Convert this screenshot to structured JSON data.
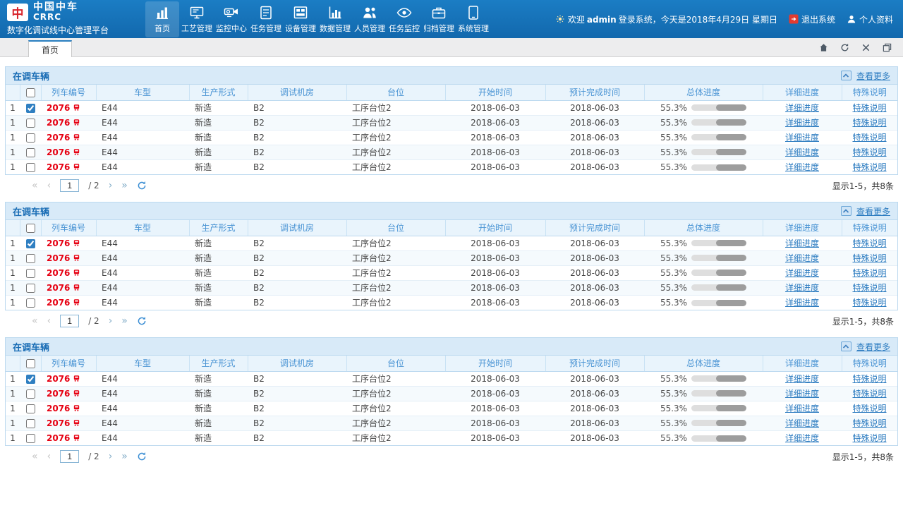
{
  "header": {
    "brand_cn": "中国中车",
    "brand_en": "CRRC",
    "logo_glyph": "中",
    "platform_name": "数字化调试线中心管理平台",
    "nav_items": [
      {
        "label": "首页",
        "icon": "home-icon",
        "active": true
      },
      {
        "label": "工艺管理",
        "icon": "process-icon",
        "active": false
      },
      {
        "label": "监控中心",
        "icon": "monitor-center-icon",
        "active": false
      },
      {
        "label": "任务管理",
        "icon": "task-icon",
        "active": false
      },
      {
        "label": "设备管理",
        "icon": "device-icon",
        "active": false
      },
      {
        "label": "数据管理",
        "icon": "data-icon",
        "active": false
      },
      {
        "label": "人员管理",
        "icon": "people-icon",
        "active": false
      },
      {
        "label": "任务监控",
        "icon": "task-monitor-icon",
        "active": false
      },
      {
        "label": "归档管理",
        "icon": "archive-icon",
        "active": false
      },
      {
        "label": "系统管理",
        "icon": "system-icon",
        "active": false
      }
    ],
    "welcome_prefix": "欢迎",
    "username": "admin",
    "welcome_suffix": "登录系统，今天是2018年4月29日 星期日",
    "logout_label": "退出系统",
    "profile_label": "个人资料"
  },
  "tabbar": {
    "tabs": [
      {
        "label": "首页",
        "active": true
      }
    ],
    "window_icons": [
      "home-icon",
      "refresh-icon",
      "close-icon",
      "windows-icon"
    ]
  },
  "pager_icons": {
    "first": "«",
    "prev": "‹",
    "next": "›",
    "last": "»"
  },
  "panels": [
    {
      "title": "在调车辆",
      "more_label": "查看更多",
      "columns": [
        "列车编号",
        "车型",
        "生产形式",
        "调试机房",
        "台位",
        "开始时间",
        "预计完成时间",
        "总体进度",
        "详细进度",
        "特殊说明"
      ],
      "rows": [
        {
          "num": "1",
          "checked": true,
          "train_no": "2076",
          "model": "E44",
          "production": "新造",
          "room": "B2",
          "station": "工序台位2",
          "start": "2018-06-03",
          "due": "2018-06-03",
          "progress_pct": 55.3,
          "progress_label": "55.3%",
          "detail_link": "详细进度",
          "special_link": "特殊说明"
        },
        {
          "num": "1",
          "checked": false,
          "train_no": "2076",
          "model": "E44",
          "production": "新造",
          "room": "B2",
          "station": "工序台位2",
          "start": "2018-06-03",
          "due": "2018-06-03",
          "progress_pct": 55.3,
          "progress_label": "55.3%",
          "detail_link": "详细进度",
          "special_link": "特殊说明"
        },
        {
          "num": "1",
          "checked": false,
          "train_no": "2076",
          "model": "E44",
          "production": "新造",
          "room": "B2",
          "station": "工序台位2",
          "start": "2018-06-03",
          "due": "2018-06-03",
          "progress_pct": 55.3,
          "progress_label": "55.3%",
          "detail_link": "详细进度",
          "special_link": "特殊说明"
        },
        {
          "num": "1",
          "checked": false,
          "train_no": "2076",
          "model": "E44",
          "production": "新造",
          "room": "B2",
          "station": "工序台位2",
          "start": "2018-06-03",
          "due": "2018-06-03",
          "progress_pct": 55.3,
          "progress_label": "55.3%",
          "detail_link": "详细进度",
          "special_link": "特殊说明"
        },
        {
          "num": "1",
          "checked": false,
          "train_no": "2076",
          "model": "E44",
          "production": "新造",
          "room": "B2",
          "station": "工序台位2",
          "start": "2018-06-03",
          "due": "2018-06-03",
          "progress_pct": 55.3,
          "progress_label": "55.3%",
          "detail_link": "详细进度",
          "special_link": "特殊说明"
        }
      ],
      "pagination": {
        "page_value": "1",
        "page_total": "/ 2",
        "summary": "显示1-5，共8条"
      }
    },
    {
      "title": "在调车辆",
      "more_label": "查看更多",
      "columns": [
        "列车编号",
        "车型",
        "生产形式",
        "调试机房",
        "台位",
        "开始时间",
        "预计完成时间",
        "总体进度",
        "详细进度",
        "特殊说明"
      ],
      "rows": [
        {
          "num": "1",
          "checked": true,
          "train_no": "2076",
          "model": "E44",
          "production": "新造",
          "room": "B2",
          "station": "工序台位2",
          "start": "2018-06-03",
          "due": "2018-06-03",
          "progress_pct": 55.3,
          "progress_label": "55.3%",
          "detail_link": "详细进度",
          "special_link": "特殊说明"
        },
        {
          "num": "1",
          "checked": false,
          "train_no": "2076",
          "model": "E44",
          "production": "新造",
          "room": "B2",
          "station": "工序台位2",
          "start": "2018-06-03",
          "due": "2018-06-03",
          "progress_pct": 55.3,
          "progress_label": "55.3%",
          "detail_link": "详细进度",
          "special_link": "特殊说明"
        },
        {
          "num": "1",
          "checked": false,
          "train_no": "2076",
          "model": "E44",
          "production": "新造",
          "room": "B2",
          "station": "工序台位2",
          "start": "2018-06-03",
          "due": "2018-06-03",
          "progress_pct": 55.3,
          "progress_label": "55.3%",
          "detail_link": "详细进度",
          "special_link": "特殊说明"
        },
        {
          "num": "1",
          "checked": false,
          "train_no": "2076",
          "model": "E44",
          "production": "新造",
          "room": "B2",
          "station": "工序台位2",
          "start": "2018-06-03",
          "due": "2018-06-03",
          "progress_pct": 55.3,
          "progress_label": "55.3%",
          "detail_link": "详细进度",
          "special_link": "特殊说明"
        },
        {
          "num": "1",
          "checked": false,
          "train_no": "2076",
          "model": "E44",
          "production": "新造",
          "room": "B2",
          "station": "工序台位2",
          "start": "2018-06-03",
          "due": "2018-06-03",
          "progress_pct": 55.3,
          "progress_label": "55.3%",
          "detail_link": "详细进度",
          "special_link": "特殊说明"
        }
      ],
      "pagination": {
        "page_value": "1",
        "page_total": "/ 2",
        "summary": "显示1-5，共8条"
      }
    },
    {
      "title": "在调车辆",
      "more_label": "查看更多",
      "columns": [
        "列车编号",
        "车型",
        "生产形式",
        "调试机房",
        "台位",
        "开始时间",
        "预计完成时间",
        "总体进度",
        "详细进度",
        "特殊说明"
      ],
      "rows": [
        {
          "num": "1",
          "checked": true,
          "train_no": "2076",
          "model": "E44",
          "production": "新造",
          "room": "B2",
          "station": "工序台位2",
          "start": "2018-06-03",
          "due": "2018-06-03",
          "progress_pct": 55.3,
          "progress_label": "55.3%",
          "detail_link": "详细进度",
          "special_link": "特殊说明"
        },
        {
          "num": "1",
          "checked": false,
          "train_no": "2076",
          "model": "E44",
          "production": "新造",
          "room": "B2",
          "station": "工序台位2",
          "start": "2018-06-03",
          "due": "2018-06-03",
          "progress_pct": 55.3,
          "progress_label": "55.3%",
          "detail_link": "详细进度",
          "special_link": "特殊说明"
        },
        {
          "num": "1",
          "checked": false,
          "train_no": "2076",
          "model": "E44",
          "production": "新造",
          "room": "B2",
          "station": "工序台位2",
          "start": "2018-06-03",
          "due": "2018-06-03",
          "progress_pct": 55.3,
          "progress_label": "55.3%",
          "detail_link": "详细进度",
          "special_link": "特殊说明"
        },
        {
          "num": "1",
          "checked": false,
          "train_no": "2076",
          "model": "E44",
          "production": "新造",
          "room": "B2",
          "station": "工序台位2",
          "start": "2018-06-03",
          "due": "2018-06-03",
          "progress_pct": 55.3,
          "progress_label": "55.3%",
          "detail_link": "详细进度",
          "special_link": "特殊说明"
        },
        {
          "num": "1",
          "checked": false,
          "train_no": "2076",
          "model": "E44",
          "production": "新造",
          "room": "B2",
          "station": "工序台位2",
          "start": "2018-06-03",
          "due": "2018-06-03",
          "progress_pct": 55.3,
          "progress_label": "55.3%",
          "detail_link": "详细进度",
          "special_link": "特殊说明"
        }
      ],
      "pagination": {
        "page_value": "1",
        "page_total": "/ 2",
        "summary": "显示1-5，共8条"
      }
    }
  ]
}
